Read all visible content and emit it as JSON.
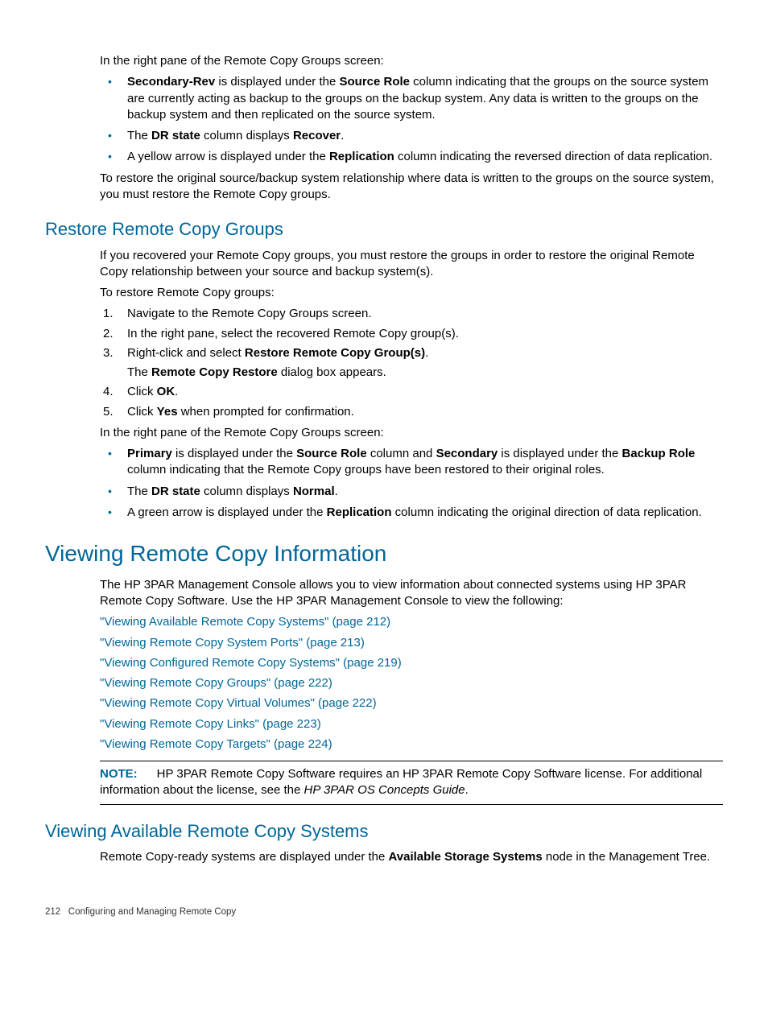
{
  "intro": {
    "line": "In the right pane of the Remote Copy Groups screen:",
    "bullets": [
      {
        "pre": "",
        "b1": "Secondary-Rev",
        "mid1": " is displayed under the ",
        "b2": "Source Role",
        "post": " column indicating that the groups on the source system are currently acting as backup to the groups on the backup system. Any data is written to the groups on the backup system and then replicated on the source system."
      },
      {
        "pre": "The ",
        "b1": "DR state",
        "mid1": " column displays ",
        "b2": "Recover",
        "post": "."
      },
      {
        "pre": "A yellow arrow is displayed under the ",
        "b1": "Replication",
        "mid1": " column indicating the reversed direction of data replication.",
        "b2": "",
        "post": ""
      }
    ],
    "after": "To restore the original source/backup system relationship where data is written to the groups on the source system, you must restore the Remote Copy groups."
  },
  "restore": {
    "heading": "Restore Remote Copy Groups",
    "p1": "If you recovered your Remote Copy groups, you must restore the groups in order to restore the original Remote Copy relationship between your source and backup system(s).",
    "p2": "To restore Remote Copy groups:",
    "steps": {
      "s1": "Navigate to the Remote Copy Groups screen.",
      "s2": "In the right pane, select the recovered Remote Copy group(s).",
      "s3a": "Right-click and select ",
      "s3b": "Restore Remote Copy Group(s)",
      "s3c": ".",
      "s3d_pre": "The ",
      "s3d_b": "Remote Copy Restore",
      "s3d_post": " dialog box appears.",
      "s4a": "Click ",
      "s4b": "OK",
      "s4c": ".",
      "s5a": "Click ",
      "s5b": "Yes",
      "s5c": " when prompted for confirmation."
    },
    "after": "In the right pane of the Remote Copy Groups screen:",
    "bullets2": {
      "b1_pre": "",
      "b1_b1": "Primary",
      "b1_m1": " is displayed under the ",
      "b1_b2": "Source Role",
      "b1_m2": " column and ",
      "b1_b3": "Secondary",
      "b1_m3": " is displayed under the ",
      "b1_b4": "Backup Role",
      "b1_post": " column indicating that the Remote Copy groups have been restored to their original roles.",
      "b2_pre": "The ",
      "b2_b1": "DR state",
      "b2_m1": " column displays ",
      "b2_b2": "Normal",
      "b2_post": ".",
      "b3_pre": "A green arrow is displayed under the ",
      "b3_b1": "Replication",
      "b3_post": " column indicating the original direction of data replication."
    }
  },
  "viewing": {
    "heading": "Viewing Remote Copy Information",
    "p1": "The HP 3PAR Management Console allows you to view information about connected systems using HP 3PAR Remote Copy Software. Use the HP 3PAR Management Console to view the following:",
    "links": [
      "\"Viewing Available Remote Copy Systems\" (page 212)",
      "\"Viewing Remote Copy System Ports\" (page 213)",
      "\"Viewing Configured Remote Copy Systems\" (page 219)",
      "\"Viewing Remote Copy Groups\" (page 222)",
      "\"Viewing Remote Copy Virtual Volumes\" (page 222)",
      "\"Viewing Remote Copy Links\" (page 223)",
      "\"Viewing Remote Copy Targets\" (page 224)"
    ],
    "note_label": "NOTE:",
    "note_text1": "HP 3PAR Remote Copy Software requires an HP 3PAR Remote Copy Software license. For additional information about the license, see the ",
    "note_italic": "HP 3PAR OS Concepts Guide",
    "note_text2": "."
  },
  "available": {
    "heading": "Viewing Available Remote Copy Systems",
    "p_pre": "Remote Copy-ready systems are displayed under the ",
    "p_b": "Available Storage Systems",
    "p_post": " node in the Management Tree."
  },
  "footer": {
    "page": "212",
    "chapter": "Configuring and Managing Remote Copy"
  }
}
